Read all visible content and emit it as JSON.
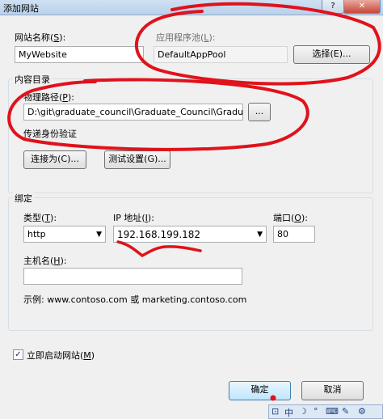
{
  "window": {
    "title": "添加网站",
    "help_glyph": "?",
    "close_glyph": "✕"
  },
  "site_name": {
    "label": "网站名称",
    "hotkey": "S",
    "value": "MyWebsite"
  },
  "app_pool": {
    "label": "应用程序池",
    "hotkey": "L",
    "value": "DefaultAppPool",
    "select_button": "选择(E)..."
  },
  "content_dir": {
    "group_title": "内容目录",
    "physical_path_label": "物理路径",
    "physical_path_hotkey": "P",
    "physical_path_value": "D:\\git\\graduate_council\\Graduate_Council\\Graduate",
    "browse_button": "...",
    "pass_through_label": "传递身份验证",
    "connect_as_button": "连接为(C)...",
    "test_settings_button": "测试设置(G)..."
  },
  "binding": {
    "group_title": "绑定",
    "type_label": "类型",
    "type_hotkey": "T",
    "type_value": "http",
    "ip_label": "IP 地址",
    "ip_hotkey": "I",
    "ip_value": "192.168.199.182",
    "port_label": "端口",
    "port_hotkey": "O",
    "port_value": "80",
    "host_label": "主机名",
    "host_hotkey": "H",
    "host_value": "",
    "example_text": "示例: www.contoso.com 或 marketing.contoso.com"
  },
  "start_now": {
    "label": "立即启动网站",
    "hotkey": "M",
    "checked": true,
    "check_glyph": "✓"
  },
  "footer": {
    "ok_button": "确定",
    "cancel_button": "取消"
  },
  "taskbar": {
    "ime_icon": "中",
    "icons": [
      "⊡",
      "中",
      "☽",
      "°",
      "⌨",
      "✎",
      "⚙"
    ]
  },
  "colors": {
    "annotation_red": "#e0121b",
    "accent_blue": "#3c7fb1"
  }
}
